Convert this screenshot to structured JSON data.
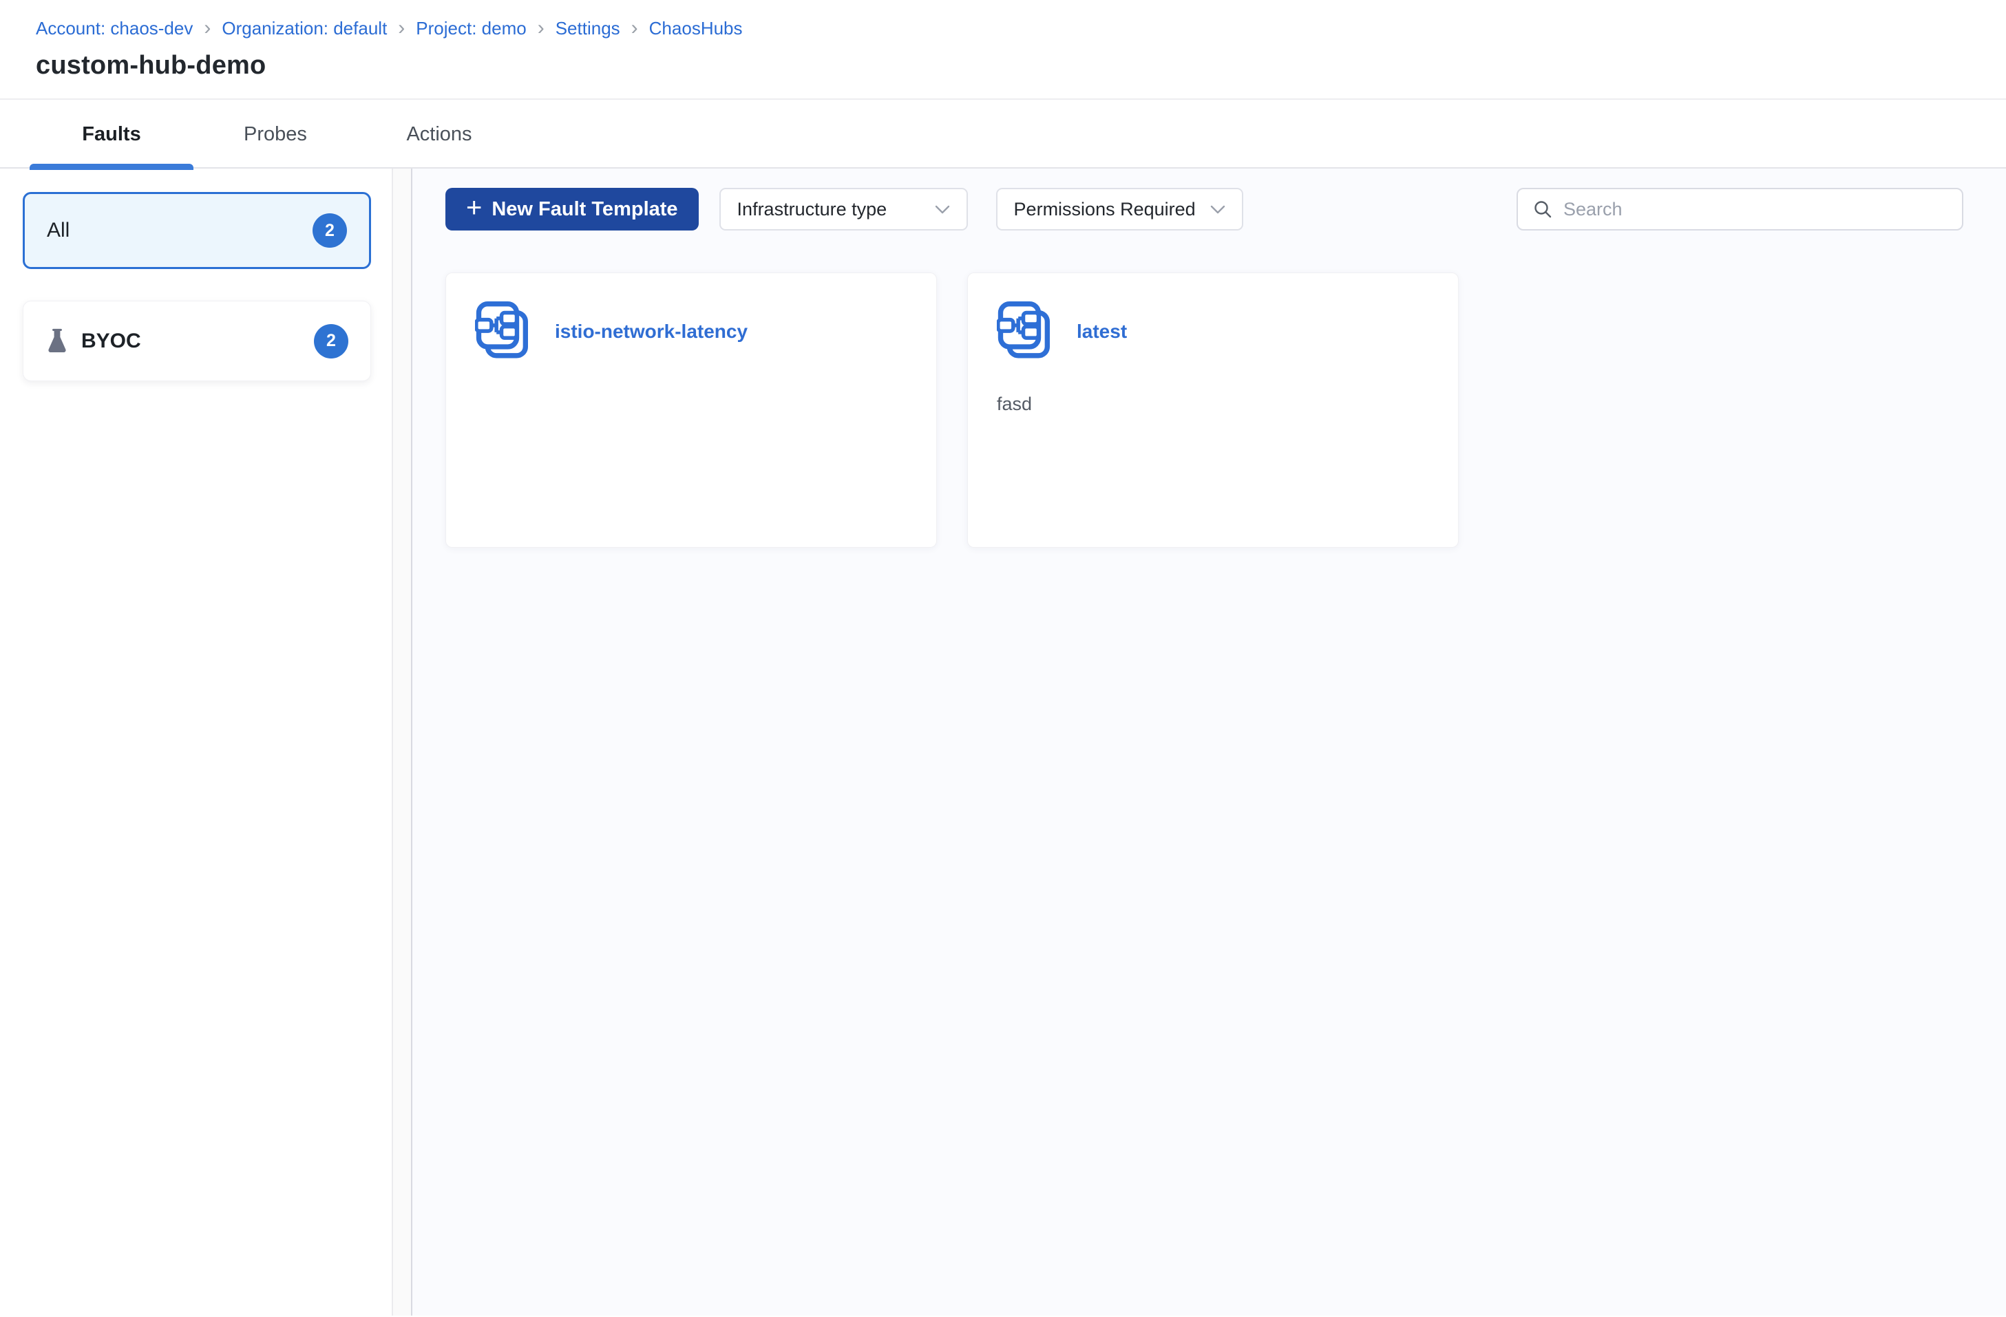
{
  "breadcrumb": {
    "separator": "›",
    "items": [
      {
        "label": "Account: chaos-dev"
      },
      {
        "label": "Organization: default"
      },
      {
        "label": "Project: demo"
      },
      {
        "label": "Settings"
      },
      {
        "label": "ChaosHubs"
      }
    ]
  },
  "page": {
    "title": "custom-hub-demo"
  },
  "tabs": [
    {
      "label": "Faults"
    },
    {
      "label": "Probes"
    },
    {
      "label": "Actions"
    }
  ],
  "sidebar": {
    "filters": [
      {
        "label": "All",
        "count": "2"
      },
      {
        "label": "BYOC",
        "count": "2",
        "icon": "flask-icon"
      }
    ]
  },
  "toolbar": {
    "new_template_button": {
      "plus": "+",
      "label": "New Fault Template"
    },
    "infrastructure_dropdown": {
      "label": "Infrastructure type"
    },
    "permissions_dropdown": {
      "label": "Permissions Required"
    },
    "search": {
      "placeholder": "Search"
    }
  },
  "templates": [
    {
      "name": "istio-network-latency",
      "description": ""
    },
    {
      "name": "latest",
      "description": "fasd"
    }
  ],
  "colors": {
    "primary_button": "#1f489e",
    "link_blue": "#2b6cd4",
    "card_title_blue": "#2f6dd3",
    "badge_blue": "#2e73d2",
    "tab_underline": "#3a7bd9",
    "selected_filter_bg": "#ecf6fd",
    "selected_filter_border": "#2b70d4",
    "main_background": "#fafbfe",
    "flask_icon_gray": "#6b7183"
  }
}
